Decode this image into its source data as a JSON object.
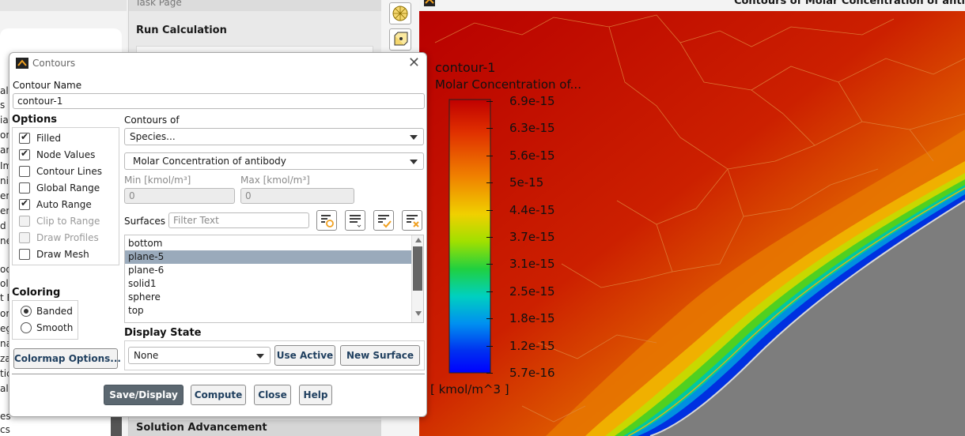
{
  "left_pane": {
    "fragments": [
      "al",
      "s",
      "ial",
      "on",
      "an",
      "Im",
      "nic",
      "en",
      "en",
      "d",
      "ne",
      "od",
      "ols",
      "t E",
      "or",
      "eg",
      "nat",
      "za",
      "tic",
      "alc",
      "es",
      "cs"
    ]
  },
  "task_page": {
    "header": "Task Page",
    "run_title": "Run Calculation",
    "section_bottom": "Solution Advancement"
  },
  "toolbar": {
    "icons": [
      "mesh-sphere-icon",
      "display-box-icon"
    ]
  },
  "graphics": {
    "window_title": "Contours of Molar Concentration of anti",
    "legend_title_1": "contour-1",
    "legend_title_2": "Molar Concentration of...",
    "legend_units": "[ kmol/m^3 ]",
    "ticks": [
      "6.9e-15",
      "6.3e-15",
      "5.6e-15",
      "5e-15",
      "4.4e-15",
      "3.7e-15",
      "3.1e-15",
      "2.5e-15",
      "1.8e-15",
      "1.2e-15",
      "5.7e-16"
    ]
  },
  "dialog": {
    "title": "Contours",
    "contour_name_label": "Contour Name",
    "contour_name_value": "contour-1",
    "options_label": "Options",
    "options": [
      {
        "label": "Filled",
        "checked": true,
        "enabled": true
      },
      {
        "label": "Node Values",
        "checked": true,
        "enabled": true
      },
      {
        "label": "Contour Lines",
        "checked": false,
        "enabled": true
      },
      {
        "label": "Global Range",
        "checked": false,
        "enabled": true
      },
      {
        "label": "Auto Range",
        "checked": true,
        "enabled": true
      },
      {
        "label": "Clip to Range",
        "checked": false,
        "enabled": false
      },
      {
        "label": "Draw Profiles",
        "checked": false,
        "enabled": false
      },
      {
        "label": "Draw Mesh",
        "checked": false,
        "enabled": true
      }
    ],
    "coloring_label": "Coloring",
    "coloring": [
      {
        "label": "Banded",
        "selected": true
      },
      {
        "label": "Smooth",
        "selected": false
      }
    ],
    "colormap_button": "Colormap Options...",
    "contours_of_label": "Contours of",
    "contours_of_value": "Species...",
    "quantity_value": "Molar Concentration of antibody",
    "min_label": "Min [kmol/m³]",
    "min_value": "0",
    "max_label": "Max [kmol/m³]",
    "max_value": "0",
    "surfaces_label": "Surfaces",
    "filter_placeholder": "Filter Text",
    "surfaces": [
      {
        "name": "bottom",
        "selected": false
      },
      {
        "name": "plane-5",
        "selected": true
      },
      {
        "name": "plane-6",
        "selected": false
      },
      {
        "name": "solid1",
        "selected": false
      },
      {
        "name": "sphere",
        "selected": false
      },
      {
        "name": "top",
        "selected": false
      }
    ],
    "display_state_label": "Display State",
    "display_state_value": "None",
    "use_active_button": "Use Active",
    "new_surface_button": "New Surface",
    "buttons": {
      "save_display": "Save/Display",
      "compute": "Compute",
      "close": "Close",
      "help": "Help"
    }
  },
  "colors": {
    "accent_selected": "#9aaabb",
    "primary_button": "#5b6770",
    "contour_high": "#c00000",
    "contour_low": "#0000ff"
  }
}
